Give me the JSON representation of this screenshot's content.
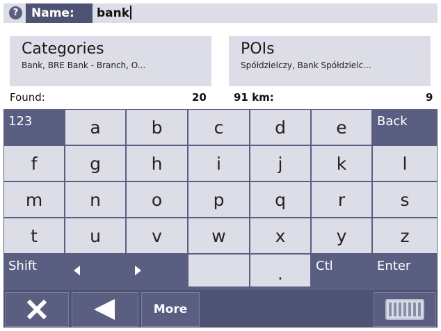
{
  "search": {
    "label": "Name:",
    "value": "bank"
  },
  "categories": {
    "title": "Categories",
    "subtitle": "Bank, BRE Bank - Branch, O..."
  },
  "pois": {
    "title": "POIs",
    "subtitle": "Spółdzielczy, Bank Spółdzielc..."
  },
  "found": {
    "label": "Found:",
    "count": "20",
    "distance_label": "91 km:",
    "distance_count": "9"
  },
  "keys": {
    "row1": [
      "123",
      "a",
      "b",
      "c",
      "d",
      "e",
      "Back"
    ],
    "row2": [
      "f",
      "g",
      "h",
      "i",
      "j",
      "k",
      "l"
    ],
    "row3": [
      "m",
      "n",
      "o",
      "p",
      "q",
      "r",
      "s"
    ],
    "row4": [
      "t",
      "u",
      "v",
      "w",
      "x",
      "y",
      "z"
    ],
    "row5": {
      "shift": "Shift",
      "dot": ".",
      "ctl": "Ctl",
      "enter": "Enter"
    }
  },
  "bottom": {
    "more": "More"
  },
  "icons": {
    "help": "question-icon",
    "close": "close-icon",
    "back": "back-arrow-icon",
    "keyboard": "keyboard-icon",
    "left": "arrow-left-icon",
    "right": "arrow-right-icon"
  },
  "colors": {
    "dark": "#5a5f82",
    "darker": "#4f5373",
    "light": "#dcdde6"
  }
}
